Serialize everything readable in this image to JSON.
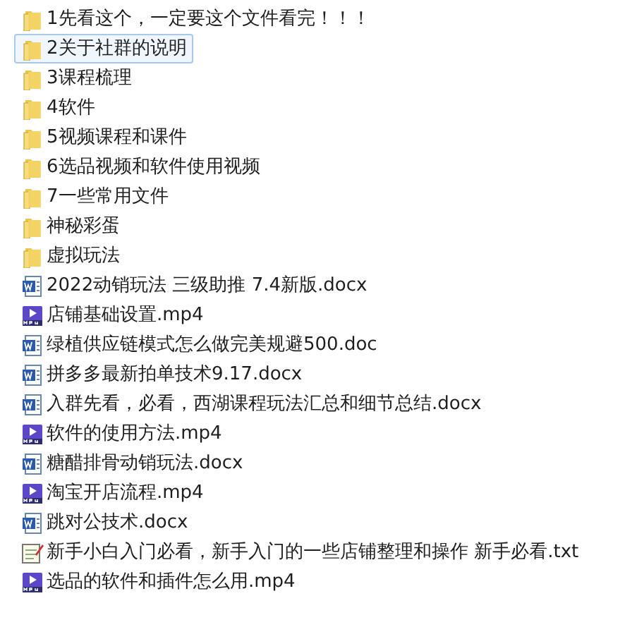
{
  "files": [
    {
      "name": "1先看这个，一定要这个文件看完！！！",
      "kind": "folder",
      "selected": false
    },
    {
      "name": "2关于社群的说明",
      "kind": "folder",
      "selected": true
    },
    {
      "name": "3课程梳理",
      "kind": "folder",
      "selected": false
    },
    {
      "name": "4软件",
      "kind": "folder",
      "selected": false
    },
    {
      "name": "5视频课程和课件",
      "kind": "folder",
      "selected": false
    },
    {
      "name": "6选品视频和软件使用视频",
      "kind": "folder",
      "selected": false
    },
    {
      "name": "7一些常用文件",
      "kind": "folder",
      "selected": false
    },
    {
      "name": "神秘彩蛋",
      "kind": "folder",
      "selected": false
    },
    {
      "name": "虚拟玩法",
      "kind": "folder",
      "selected": false
    },
    {
      "name": "2022动销玩法  三级助推 7.4新版.docx",
      "kind": "doc",
      "selected": false
    },
    {
      "name": "店铺基础设置.mp4",
      "kind": "video",
      "selected": false
    },
    {
      "name": "绿植供应链模式怎么做完美规避500.doc",
      "kind": "doc",
      "selected": false
    },
    {
      "name": "拼多多最新拍单技术9.17.docx",
      "kind": "doc",
      "selected": false
    },
    {
      "name": "入群先看，必看，西湖课程玩法汇总和细节总结.docx",
      "kind": "doc",
      "selected": false
    },
    {
      "name": "软件的使用方法.mp4",
      "kind": "video",
      "selected": false
    },
    {
      "name": "糖醋排骨动销玩法.docx",
      "kind": "doc",
      "selected": false
    },
    {
      "name": "淘宝开店流程.mp4",
      "kind": "video",
      "selected": false
    },
    {
      "name": "跳对公技术.docx",
      "kind": "doc",
      "selected": false
    },
    {
      "name": "新手小白入门必看，新手入门的一些店铺整理和操作  新手必看.txt",
      "kind": "text",
      "selected": false
    },
    {
      "name": "选品的软件和插件怎么用.mp4",
      "kind": "video",
      "selected": false
    }
  ]
}
